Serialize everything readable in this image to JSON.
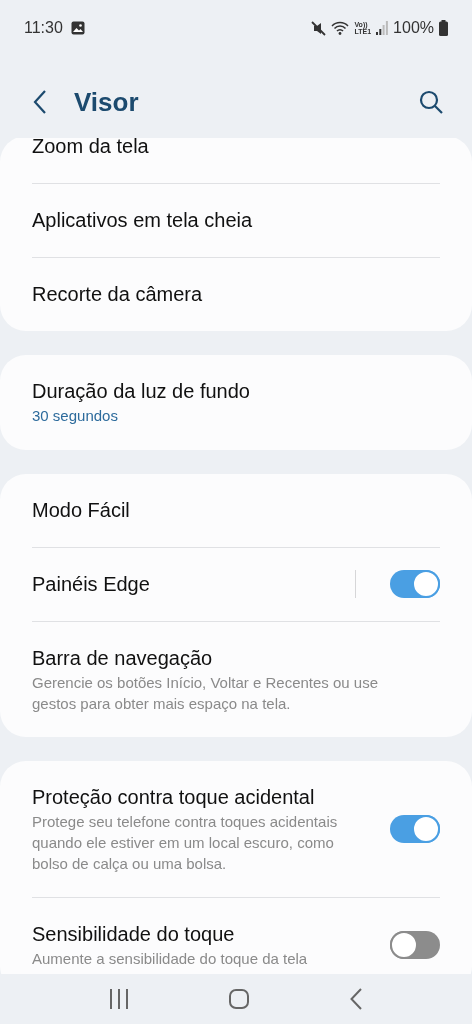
{
  "status_bar": {
    "time": "11:30",
    "network_label": [
      "Vo))",
      "LTE1"
    ],
    "battery": "100%"
  },
  "header": {
    "title": "Visor"
  },
  "groups": [
    {
      "items": [
        {
          "kind": "link",
          "title": "Zoom da tela"
        },
        {
          "kind": "link",
          "title": "Aplicativos em tela cheia"
        },
        {
          "kind": "link",
          "title": "Recorte da câmera"
        }
      ]
    },
    {
      "items": [
        {
          "kind": "link",
          "title": "Duração da luz de fundo",
          "value": "30 segundos"
        }
      ]
    },
    {
      "items": [
        {
          "kind": "link",
          "title": "Modo Fácil"
        },
        {
          "kind": "split_switch",
          "title": "Painéis Edge",
          "on": true
        },
        {
          "kind": "link",
          "title": "Barra de navegação",
          "summary": "Gerencie os botões Início, Voltar e Recentes ou use gestos para obter mais espaço na tela."
        }
      ]
    },
    {
      "items": [
        {
          "kind": "switch",
          "title": "Proteção contra toque acidental",
          "summary": "Protege seu telefone contra toques acidentais quando ele estiver em um local escuro, como bolso de calça ou uma bolsa.",
          "on": true
        },
        {
          "kind": "switch",
          "title": "Sensibilidade do toque",
          "summary": "Aumente a sensibilidade do toque da tela",
          "on": false
        }
      ]
    }
  ]
}
